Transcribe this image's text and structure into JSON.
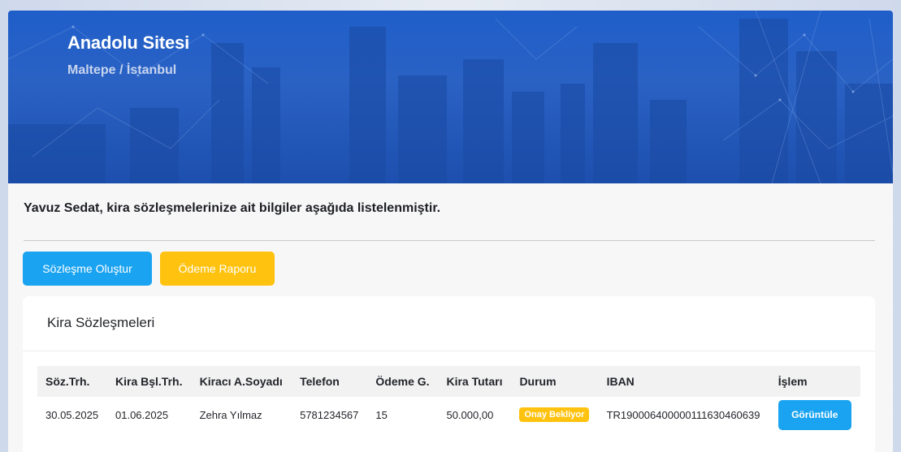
{
  "hero": {
    "title": "Anadolu Sitesi",
    "subtitle": "Maltepe / İstanbul"
  },
  "intro_text": "Yavuz Sedat, kira sözleşmelerinize ait bilgiler aşağıda listelenmiştir.",
  "actions": {
    "create_contract": "Sözleşme Oluştur",
    "payment_report": "Ödeme Raporu"
  },
  "contracts_panel": {
    "title": "Kira Sözleşmeleri",
    "columns": [
      "Söz.Trh.",
      "Kira Bşl.Trh.",
      "Kiracı A.Soyadı",
      "Telefon",
      "Ödeme G.",
      "Kira Tutarı",
      "Durum",
      "IBAN",
      "İşlem"
    ],
    "rows": [
      {
        "contract_date": "30.05.2025",
        "start_date": "01.06.2025",
        "tenant": "Zehra Yılmaz",
        "phone": "5781234567",
        "payment_day": "15",
        "amount": "50.000,00",
        "status": "Onay Bekliyor",
        "iban": "TR190006400000111630460639",
        "action": "Görüntüle"
      }
    ]
  },
  "colors": {
    "primary": "#1aa3f1",
    "warning": "#ffc20e",
    "hero_blue": "#1f5ec9"
  }
}
